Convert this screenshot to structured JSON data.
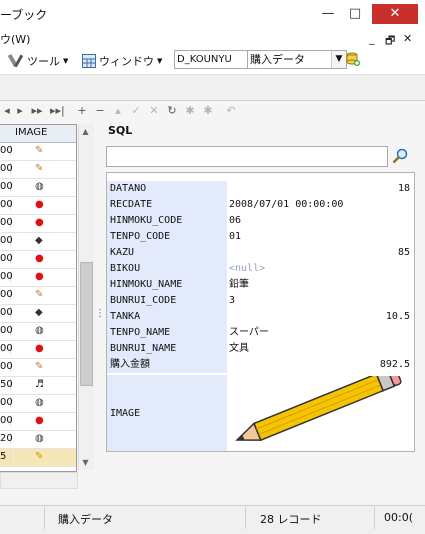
{
  "window": {
    "title": "ーブック",
    "minimize_glyph": "—",
    "maximize_glyph": "□",
    "close_glyph": "✕"
  },
  "menu": {
    "window_menu": "ウ(W)",
    "mdi_min": "_",
    "mdi_restore": "🗗",
    "mdi_close": "✕"
  },
  "toolbar": {
    "tools_label": "ツール",
    "window_label": "ウィンドウ",
    "connection": "D_KOUNYU",
    "query": "購入データ"
  },
  "navigator": {
    "buttons": [
      "◂",
      "▸",
      "▸▸",
      "▸▸|",
      "+",
      "−",
      "▴",
      "✓",
      "✕",
      "↻",
      "✱",
      "✱",
      "↶"
    ]
  },
  "grid": {
    "column_header": "IMAGE",
    "rows": [
      {
        "num": "00",
        "img": "pencil",
        "glyph": "✎"
      },
      {
        "num": "00",
        "img": "pencil",
        "glyph": "✎"
      },
      {
        "num": "00",
        "img": "bento",
        "glyph": "◍"
      },
      {
        "num": "00",
        "img": "apple",
        "glyph": "●"
      },
      {
        "num": "00",
        "img": "apple",
        "glyph": "●"
      },
      {
        "num": "00",
        "img": "camera",
        "glyph": "◆"
      },
      {
        "num": "00",
        "img": "apple",
        "glyph": "●"
      },
      {
        "num": "00",
        "img": "apple",
        "glyph": "●"
      },
      {
        "num": "00",
        "img": "pencil",
        "glyph": "✎"
      },
      {
        "num": "00",
        "img": "camera",
        "glyph": "◆"
      },
      {
        "num": "00",
        "img": "bento",
        "glyph": "◍"
      },
      {
        "num": "00",
        "img": "apple",
        "glyph": "●"
      },
      {
        "num": "00",
        "img": "pencil",
        "glyph": "✎"
      },
      {
        "num": "50",
        "img": "piano",
        "glyph": "♬"
      },
      {
        "num": "00",
        "img": "bento",
        "glyph": "◍"
      },
      {
        "num": "00",
        "img": "apple",
        "glyph": "●"
      },
      {
        "num": "20",
        "img": "bento",
        "glyph": "◍"
      },
      {
        "num": "5",
        "img": "pencil-selected",
        "glyph": "✎"
      }
    ]
  },
  "record_panel": {
    "sql_label": "SQL",
    "search_placeholder": "",
    "fields": [
      {
        "name": "DATANO",
        "value": "18",
        "align": "right"
      },
      {
        "name": "RECDATE",
        "value": "2008/07/01 00:00:00",
        "align": "left"
      },
      {
        "name": "HINMOKU_CODE",
        "value": "06",
        "align": "left"
      },
      {
        "name": "TENPO_CODE",
        "value": "01",
        "align": "left"
      },
      {
        "name": "KAZU",
        "value": "85",
        "align": "right"
      },
      {
        "name": "BIKOU",
        "value": "<null>",
        "align": "null"
      },
      {
        "name": "HINMOKU_NAME",
        "value": "鉛筆",
        "align": "left"
      },
      {
        "name": "BUNRUI_CODE",
        "value": "3",
        "align": "left"
      },
      {
        "name": "TANKA",
        "value": "10.5",
        "align": "right"
      },
      {
        "name": "TENPO_NAME",
        "value": "スーパー",
        "align": "left"
      },
      {
        "name": "BUNRUI_NAME",
        "value": "文具",
        "align": "left"
      },
      {
        "name": "購入金額",
        "value": "892.5",
        "align": "right"
      }
    ],
    "image_field": "IMAGE"
  },
  "status": {
    "query_name": "購入データ",
    "record_count": "28 レコード",
    "time": "00:0("
  },
  "colors": {
    "field_name_bg": "#e3eafb",
    "selected_row": "#f6e7b8",
    "close_button": "#c9302c",
    "apple": "#e01010",
    "pencil_body": "#f5c400"
  }
}
